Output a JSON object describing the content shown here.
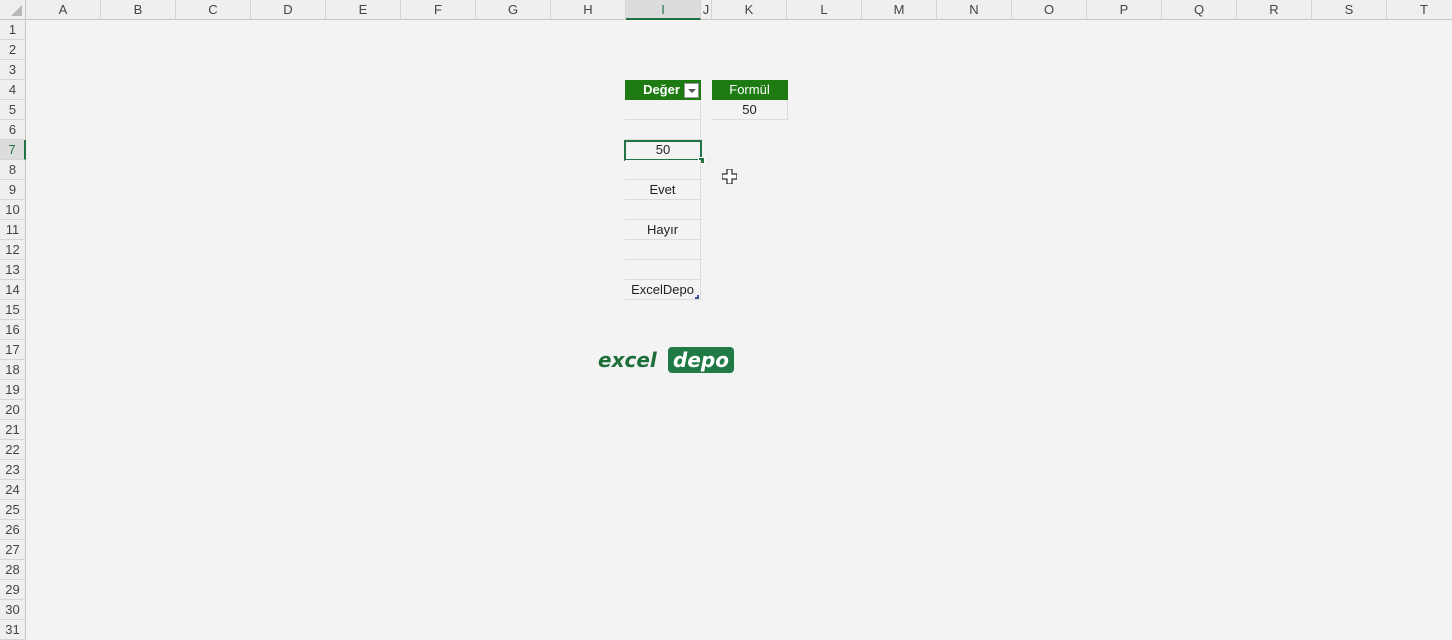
{
  "columns": [
    "A",
    "B",
    "C",
    "D",
    "E",
    "F",
    "G",
    "H",
    "I",
    "J",
    "K",
    "L",
    "M",
    "N",
    "O",
    "P",
    "Q",
    "R",
    "S",
    "T"
  ],
  "rows": [
    "1",
    "2",
    "3",
    "4",
    "5",
    "6",
    "7",
    "8",
    "9",
    "10",
    "11",
    "12",
    "13",
    "14",
    "15",
    "16",
    "17",
    "18",
    "19",
    "20",
    "21",
    "22",
    "23",
    "24",
    "25",
    "26",
    "27",
    "28",
    "29",
    "30",
    "31"
  ],
  "selected_column": "I",
  "selected_row": "7",
  "table_deger": {
    "header": "Değer",
    "values": [
      "",
      "",
      "50",
      "",
      "Evet",
      "",
      "Hayır",
      "",
      "",
      "ExcelDepo"
    ]
  },
  "table_formul": {
    "header": "Formül",
    "values": [
      "50"
    ]
  },
  "logo": {
    "part1": "excel",
    "part2": "depo"
  },
  "colors": {
    "table_header": "#1e7b12",
    "selection": "#217346",
    "logo_green": "#1f7a45"
  },
  "icons": {
    "filter": "filter-dropdown-icon",
    "cursor": "cell-select-cursor-icon"
  }
}
